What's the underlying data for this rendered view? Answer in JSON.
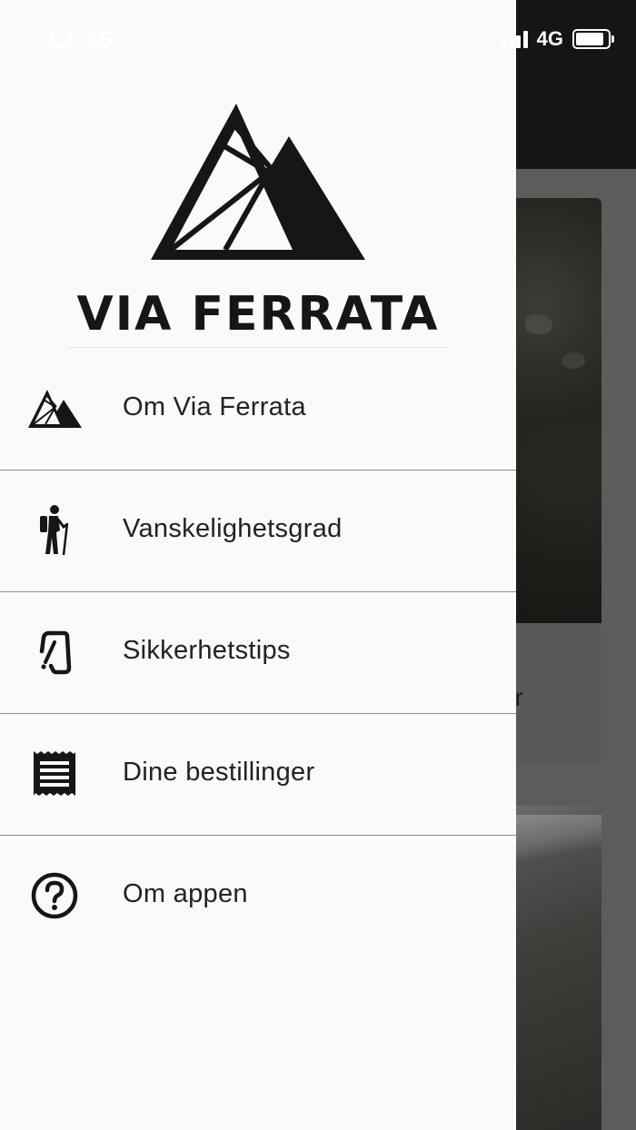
{
  "status_bar": {
    "time": "12:35",
    "network": "4G",
    "battery_level": 0.8
  },
  "drawer": {
    "brand": "VIA FERRATA",
    "menu": [
      {
        "label": "Om Via Ferrata",
        "icon": "mountain-logo-icon"
      },
      {
        "label": "Vanskelighetsgrad",
        "icon": "hiker-icon"
      },
      {
        "label": "Sikkerhetstips",
        "icon": "carabiner-icon"
      },
      {
        "label": "Dine bestillinger",
        "icon": "receipt-icon"
      },
      {
        "label": "Om appen",
        "icon": "help-circle-icon"
      }
    ]
  },
  "background_screen": {
    "card_caption_tail": "r"
  },
  "colors": {
    "drawer_background": "#fafafa",
    "text_primary": "#222222",
    "brand_dark": "#161616",
    "divider": "#8e8e8e",
    "app_bar": "#151515"
  }
}
